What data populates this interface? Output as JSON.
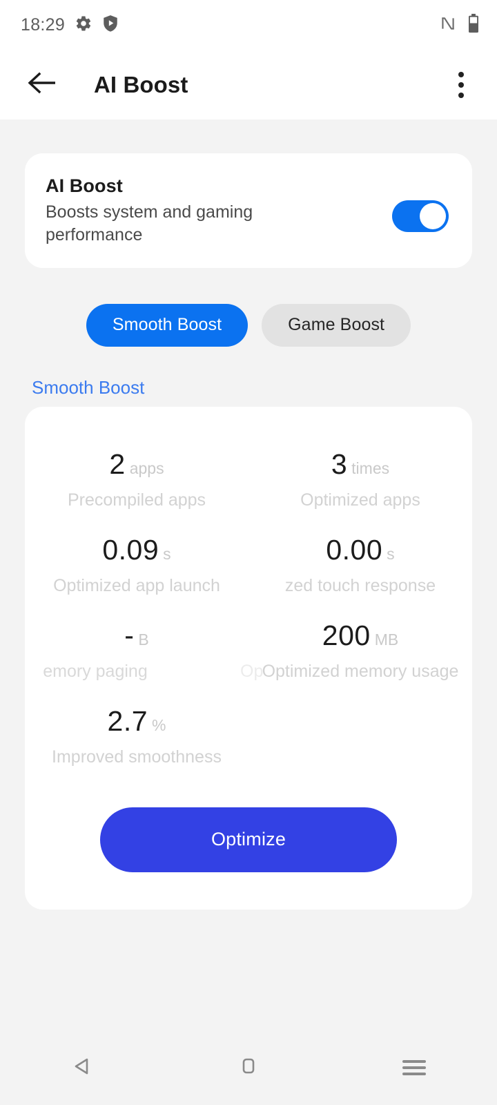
{
  "status_bar": {
    "time": "18:29",
    "left_icons": [
      "gear-icon",
      "shield-play-icon"
    ],
    "right_icons": [
      "nfc-icon",
      "battery-icon"
    ]
  },
  "app_bar": {
    "back_icon": "arrow-left-icon",
    "title": "AI Boost",
    "overflow_icon": "more-vertical-icon"
  },
  "toggle_card": {
    "title": "AI Boost",
    "subtitle": "Boosts system and gaming performance",
    "switch_on": true,
    "switch_color": "#0B72F0"
  },
  "tabs": [
    {
      "label": "Smooth Boost",
      "active": true
    },
    {
      "label": "Game Boost",
      "active": false
    }
  ],
  "section": {
    "header": "Smooth Boost",
    "header_color": "#3B7BEF"
  },
  "stats": [
    {
      "value": "2",
      "unit": "apps",
      "label": "Precompiled apps"
    },
    {
      "value": "3",
      "unit": "times",
      "label": "Optimized apps"
    },
    {
      "value": "0.09",
      "unit": "s",
      "label": "Optimized app launch"
    },
    {
      "value": "0.00",
      "unit": "s",
      "label": "zed touch response"
    },
    {
      "value": "-",
      "unit": "B",
      "label": "emory paging"
    },
    {
      "value": "200",
      "unit": "MB",
      "label": "Optimized memory usage"
    },
    {
      "value": "2.7",
      "unit": "%",
      "label": "Improved smoothness"
    }
  ],
  "ghost_text": "Op",
  "optimize_button": {
    "label": "Optimize",
    "color": "#3341E4"
  },
  "nav_bar": {
    "back_icon": "triangle-back-icon",
    "home_icon": "square-home-icon",
    "recents_icon": "menu-recents-icon"
  }
}
